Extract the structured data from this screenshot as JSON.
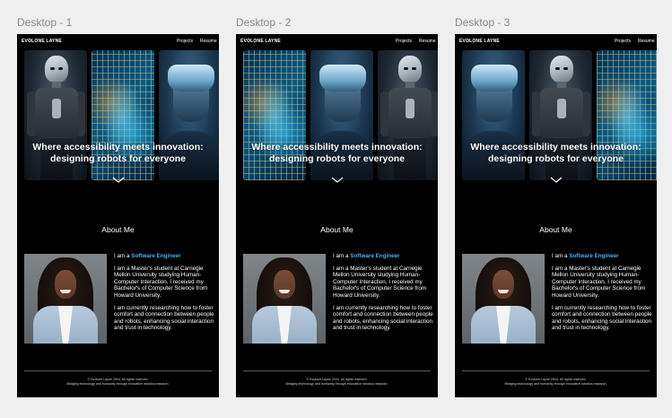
{
  "frames": [
    {
      "label": "Desktop - 1",
      "panels": [
        {
          "image": "humanoid-robot-image"
        },
        {
          "image": "glowing-tech-lights-image"
        },
        {
          "image": "vr-headset-person-image"
        }
      ]
    },
    {
      "label": "Desktop - 2",
      "panels": [
        {
          "image": "glowing-tech-lights-image"
        },
        {
          "image": "vr-headset-person-image"
        },
        {
          "image": "humanoid-robot-image"
        }
      ]
    },
    {
      "label": "Desktop - 3",
      "panels": [
        {
          "image": "vr-headset-person-image"
        },
        {
          "image": "humanoid-robot-image"
        },
        {
          "image": "glowing-tech-lights-image"
        }
      ]
    }
  ],
  "site": {
    "brand": "EVOLONE LAYNE",
    "nav": {
      "projects": "Projects",
      "resume": "Resume"
    },
    "hero_line1": "Where accessibility meets innovation:",
    "hero_line2": "designing robots for everyone",
    "chevron_icon": "chevron-down-icon",
    "about_heading": "About Me",
    "role_prefix": "I am a",
    "role": "Software Engineer",
    "bio_p1": "I am a Master's student at Carnegie Mellon University studying Human-Computer Interaction. I received my Bachelor's of Computer Science from Howard University.",
    "bio_p2": "I am currently researching how to foster comfort and connection between people and robots, enhancing social interaction and trust in technology.",
    "footer_line1": "© Evolone Layne 2024. All rights reserved.",
    "footer_line2": "Bridging technology and humanity through innovative robotics research."
  },
  "colors": {
    "canvas": "#efefef",
    "frame_bg": "#000000",
    "accent": "#48b3f2",
    "label": "#8a8a8a"
  }
}
